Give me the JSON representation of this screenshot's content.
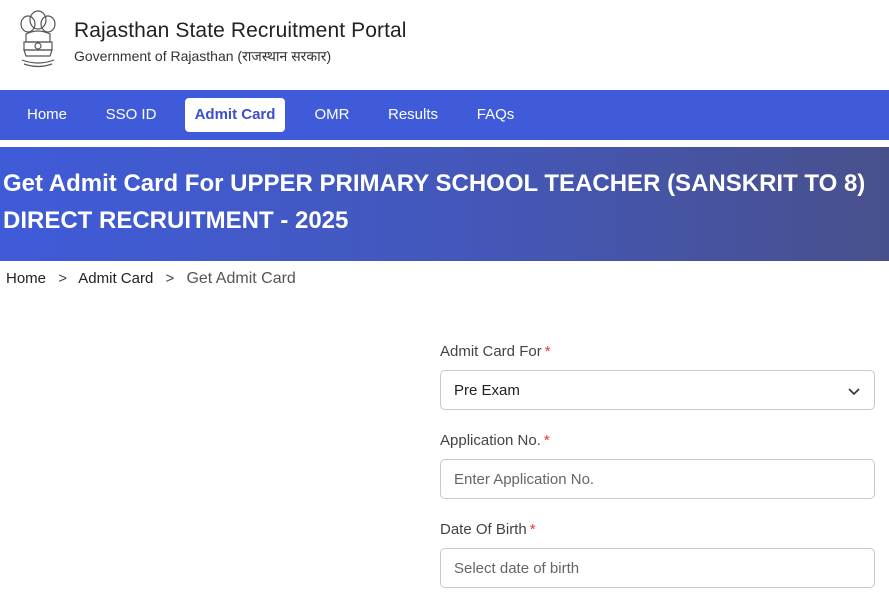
{
  "header": {
    "title": "Rajasthan State Recruitment Portal",
    "subtitle": "Government of Rajasthan (राजस्थान सरकार)"
  },
  "nav": {
    "items": [
      {
        "label": "Home"
      },
      {
        "label": "SSO ID"
      },
      {
        "label": "Admit Card",
        "active": true
      },
      {
        "label": "OMR"
      },
      {
        "label": "Results"
      },
      {
        "label": "FAQs"
      }
    ]
  },
  "banner": {
    "title": "Get Admit Card For UPPER PRIMARY SCHOOL TEACHER (SANSKRIT TO 8) DIRECT RECRUITMENT - 2025"
  },
  "breadcrumb": {
    "home": "Home",
    "admit_card": "Admit Card",
    "current": "Get Admit Card",
    "separator": ">"
  },
  "form": {
    "admit_card_for": {
      "label": "Admit Card For",
      "value": "Pre Exam",
      "required_mark": "*"
    },
    "application_no": {
      "label": "Application No.",
      "placeholder": "Enter Application No.",
      "required_mark": "*"
    },
    "dob": {
      "label": "Date Of Birth",
      "placeholder": "Select date of birth",
      "required_mark": "*"
    }
  },
  "colors": {
    "nav_bg": "#3f5bd9",
    "banner_start": "#3f5bd9",
    "banner_end": "#48508c",
    "required": "#e53935"
  }
}
